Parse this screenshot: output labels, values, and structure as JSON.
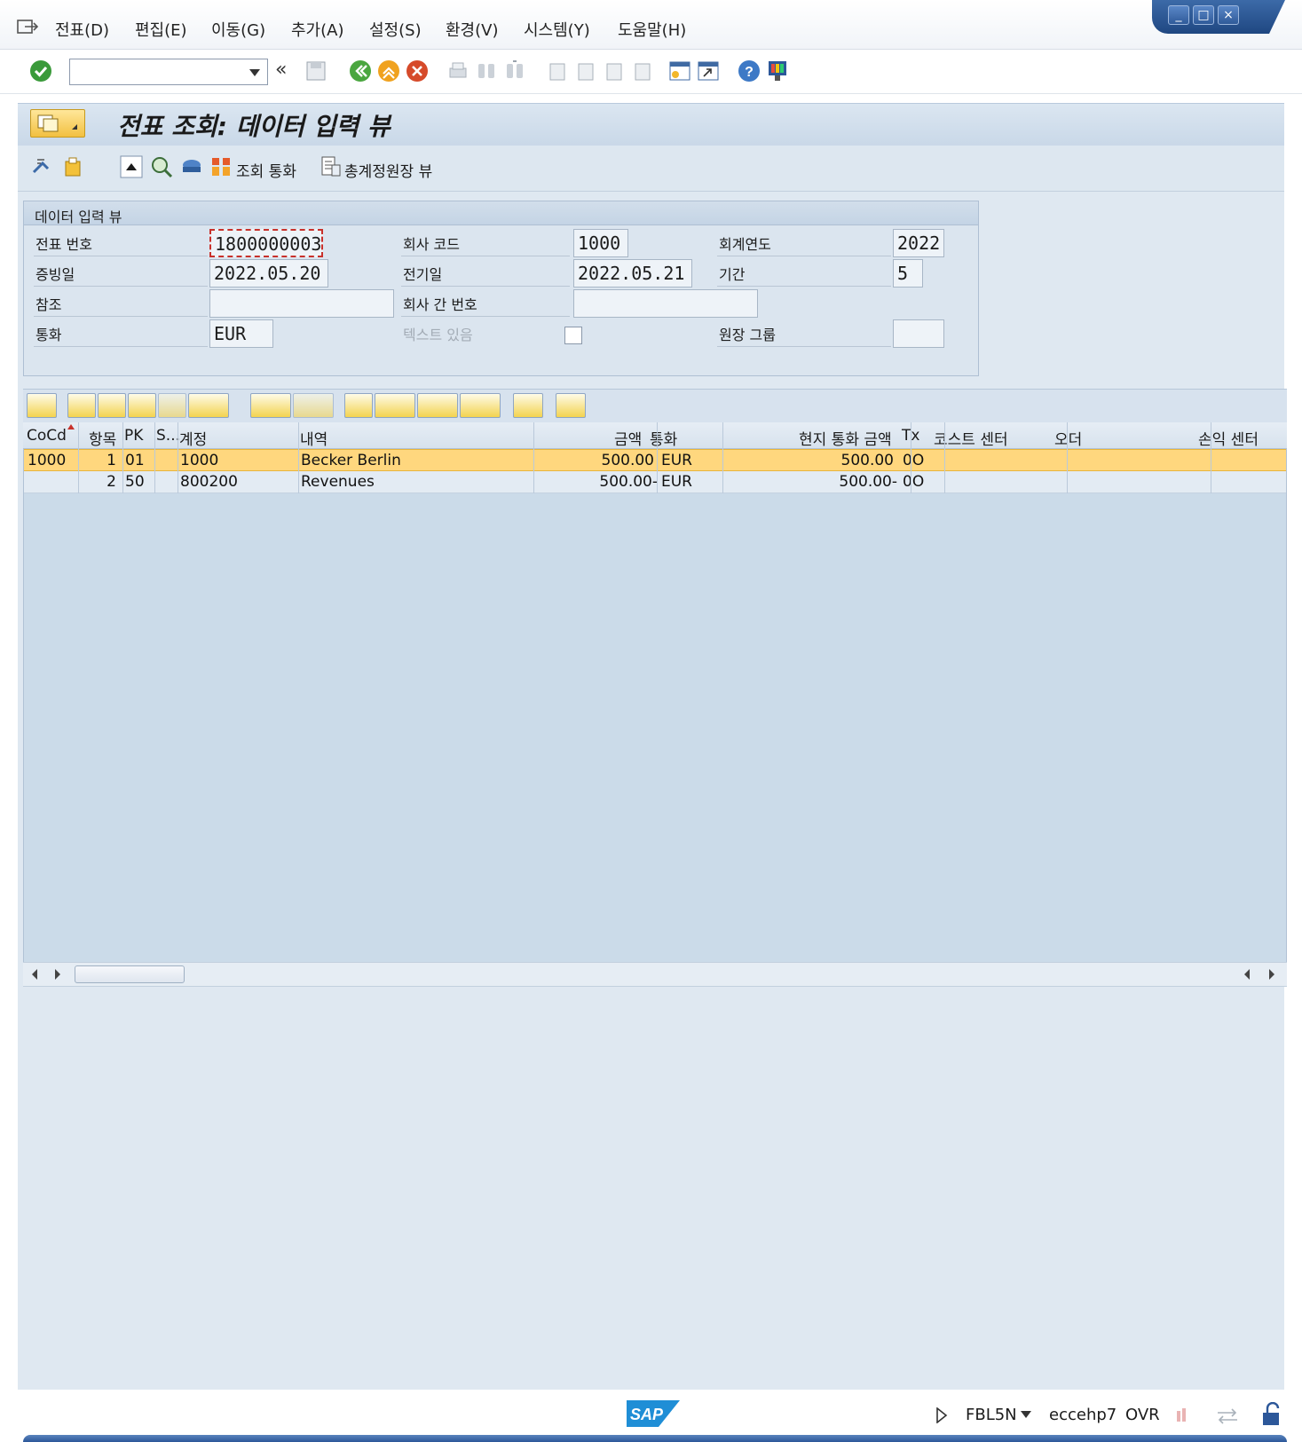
{
  "menu": {
    "items": [
      {
        "label": "전표(D)"
      },
      {
        "label": "편집(E)"
      },
      {
        "label": "이동(G)"
      },
      {
        "label": "추가(A)"
      },
      {
        "label": "설정(S)"
      },
      {
        "label": "환경(V)"
      },
      {
        "label": "시스템(Y)"
      },
      {
        "label": "도움말(H)"
      }
    ]
  },
  "system_toolbar": {
    "command_value": "",
    "collapse_label": "«"
  },
  "title": "전표 조회: 데이터 입력 뷰",
  "app_toolbar": {
    "display_currency_label": "조회 통화",
    "general_ledger_view_label": "총계정원장 뷰"
  },
  "form": {
    "section_title": "데이터 입력 뷰",
    "document_number": {
      "label": "전표 번호",
      "value": "1800000003"
    },
    "company_code": {
      "label": "회사 코드",
      "value": "1000"
    },
    "fiscal_year": {
      "label": "회계연도",
      "value": "2022"
    },
    "document_date": {
      "label": "증빙일",
      "value": "2022.05.20"
    },
    "posting_date": {
      "label": "전기일",
      "value": "2022.05.21"
    },
    "period": {
      "label": "기간",
      "value": "5"
    },
    "reference": {
      "label": "참조",
      "value": ""
    },
    "intercompany_number": {
      "label": "회사 간 번호",
      "value": ""
    },
    "currency": {
      "label": "통화",
      "value": "EUR"
    },
    "text_exists": {
      "label": "텍스트 있음",
      "checked": false
    },
    "ledger_group": {
      "label": "원장 그룹",
      "value": ""
    }
  },
  "grid": {
    "columns": [
      "CoCd",
      "항목",
      "PK",
      "S...",
      "계정",
      "내역",
      "금액",
      "통화",
      "현지 통화 금액",
      "Tx",
      "코스트 센터",
      "오더",
      "손익 센터"
    ],
    "rows": [
      {
        "cocd": "1000",
        "item": "1",
        "pk": "01",
        "s": "",
        "account": "1000",
        "text": "Becker Berlin",
        "amount": "500.00",
        "currency": "EUR",
        "local_amount": "500.00",
        "tx": "0O",
        "cost_center": "",
        "order": "",
        "profit_center": "",
        "selected": true
      },
      {
        "cocd": "",
        "item": "2",
        "pk": "50",
        "s": "",
        "account": "800200",
        "text": "Revenues",
        "amount": "500.00-",
        "currency": "EUR",
        "local_amount": "500.00-",
        "tx": "0O",
        "cost_center": "",
        "order": "",
        "profit_center": "",
        "selected": false
      }
    ]
  },
  "status": {
    "logo": "SAP",
    "transaction": "FBL5N",
    "server": "eccehp7",
    "mode": "OVR"
  },
  "colors": {
    "selected_row": "#ffd77e",
    "grid_bg": "#cbdbe9",
    "title_bg": "#c9d8e8",
    "accent": "#2c5799"
  }
}
